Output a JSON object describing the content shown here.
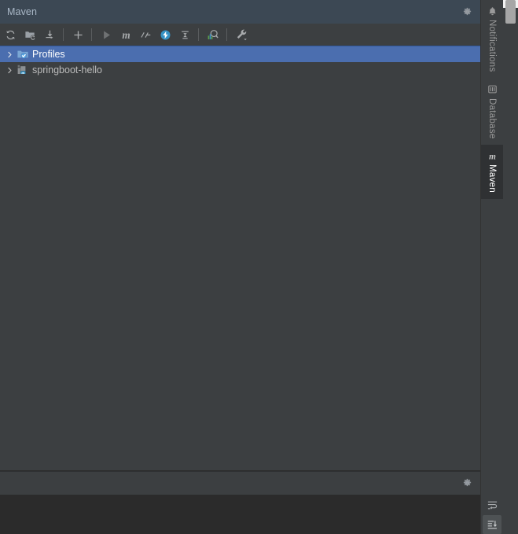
{
  "window": {
    "title": "Maven",
    "settings_icon": "gear-icon",
    "minimize_icon": "minimize-icon"
  },
  "colors": {
    "titlebar_bg": "#3c4854",
    "panel_bg": "#3c3f41",
    "console_bg": "#2b2b2b",
    "selection_blue": "#4b6eaf",
    "accent_blue": "#3592c4",
    "text": "#bbbbbb",
    "title_text": "#a9b7c6"
  },
  "toolbar": {
    "buttons": [
      {
        "name": "reload-all-maven-projects-button",
        "icon": "refresh-icon",
        "tooltip": "Reload All Maven Projects"
      },
      {
        "name": "add-maven-project-button",
        "icon": "folder-refresh-icon",
        "tooltip": "Add Maven Projects"
      },
      {
        "name": "download-sources-button",
        "icon": "download-icon",
        "tooltip": "Download Sources and/or Documentation"
      },
      {
        "name": "separator-1",
        "icon": "separator",
        "tooltip": ""
      },
      {
        "name": "add-button",
        "icon": "plus-icon",
        "tooltip": "Add"
      },
      {
        "name": "separator-2",
        "icon": "separator",
        "tooltip": ""
      },
      {
        "name": "run-maven-build-button",
        "icon": "play-icon",
        "tooltip": "Run Maven Build"
      },
      {
        "name": "execute-maven-goal-button",
        "icon": "m-letter-icon",
        "tooltip": "Execute Maven Goal"
      },
      {
        "name": "skip-tests-button",
        "icon": "skip-tests-icon",
        "tooltip": "Toggle 'Skip Tests' Mode"
      },
      {
        "name": "toggle-offline-mode-button",
        "icon": "offline-bolt-icon",
        "tooltip": "Toggle Offline Mode"
      },
      {
        "name": "collapse-all-button",
        "icon": "collapse-all-icon",
        "tooltip": "Collapse All"
      },
      {
        "name": "separator-3",
        "icon": "separator",
        "tooltip": ""
      },
      {
        "name": "show-dependencies-button",
        "icon": "analyze-dependencies-icon",
        "tooltip": "Show Dependencies"
      },
      {
        "name": "separator-4",
        "icon": "separator",
        "tooltip": ""
      },
      {
        "name": "maven-settings-button",
        "icon": "wrench-dropdown-icon",
        "tooltip": "Maven Settings"
      }
    ]
  },
  "tree": {
    "nodes": [
      {
        "label": "Profiles",
        "icon": "profiles-folder-icon",
        "expanded": false,
        "selected": true,
        "arrow": "chevron-right-icon"
      },
      {
        "label": "springboot-hello",
        "icon": "maven-module-icon",
        "expanded": false,
        "selected": false,
        "arrow": "chevron-right-icon"
      }
    ]
  },
  "stripe": {
    "tabs": [
      {
        "label": "Notifications",
        "icon": "bell-icon",
        "active": false
      },
      {
        "label": "Database",
        "icon": "database-icon",
        "active": false
      },
      {
        "label": "Maven",
        "icon": "m-letter-icon",
        "active": true
      }
    ]
  },
  "bottom_panel": {
    "settings_icon": "gear-icon",
    "minimize_icon": "minimize-icon",
    "gutter_buttons": [
      {
        "name": "soft-wrap-button",
        "icon": "soft-wrap-icon",
        "active": false
      },
      {
        "name": "scroll-to-end-button",
        "icon": "scroll-to-end-icon",
        "active": true
      }
    ],
    "console_text": ""
  }
}
